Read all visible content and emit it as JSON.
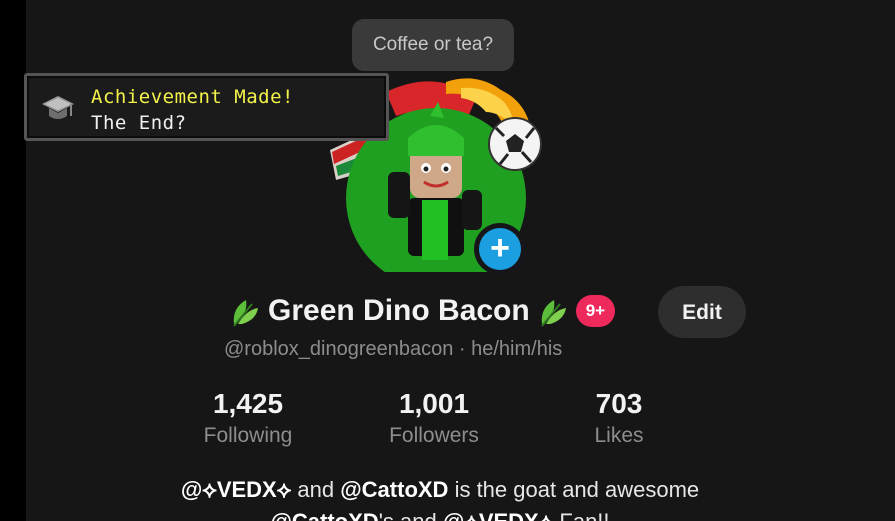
{
  "bubble": {
    "text": "Coffee or tea?"
  },
  "achievement": {
    "title": "Achievement Made!",
    "subtitle": "The End?"
  },
  "profile": {
    "display_name": "Green Dino Bacon",
    "badge": "9+",
    "edit_label": "Edit",
    "handle_line": "@roblox_dinogreenbacon · he/him/his"
  },
  "stats": {
    "following": {
      "value": "1,425",
      "label": "Following"
    },
    "followers": {
      "value": "1,001",
      "label": "Followers"
    },
    "likes": {
      "value": "703",
      "label": "Likes"
    }
  },
  "bio": {
    "mention1": "@⟡VEDX⟡",
    "and1": " and ",
    "mention2": "@CattoXD",
    "rest1": " is the goat and awesome",
    "mention3": "@CattoXD",
    "apostrophe_and": "'s and ",
    "mention4": "@⟡VEDX⟡",
    "tail": " Fan!!"
  },
  "colors": {
    "accent_blue": "#1c9fe0",
    "badge_pink": "#ee2a5d",
    "achievement_yellow": "#f2f24a",
    "avatar_green": "#20a020"
  },
  "icons": {
    "achievement": "graduation-cap-icon",
    "add": "plus-icon",
    "leaf": "leaf-icon"
  }
}
